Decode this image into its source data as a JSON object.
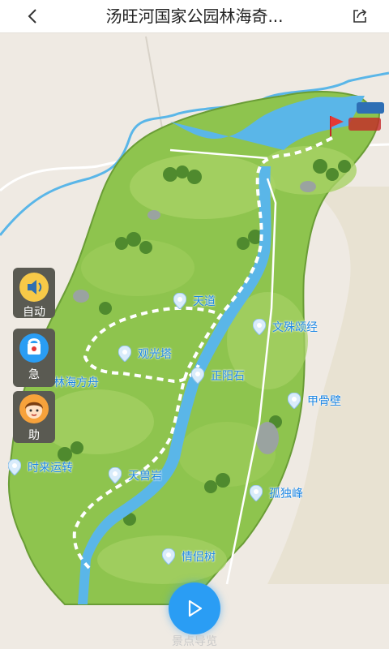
{
  "header": {
    "title": "汤旺河国家公园林海奇...",
    "back_icon": "chevron-left-icon",
    "share_icon": "share-icon"
  },
  "colors": {
    "water": "#5ab6e8",
    "park_green": "#8ec44e",
    "pin_blue": "#1e88e5",
    "route": "#ffffff",
    "button_blue": "#2a9df4"
  },
  "side_buttons": [
    {
      "label": "自动",
      "icon": "speaker-icon"
    },
    {
      "label": "急",
      "icon": "emergency-phone-icon"
    },
    {
      "label": "助",
      "icon": "guide-avatar-icon"
    }
  ],
  "pois": [
    {
      "name": "天道"
    },
    {
      "name": "文殊颂经"
    },
    {
      "name": "观光塔"
    },
    {
      "name": "林海方舟"
    },
    {
      "name": "正阳石"
    },
    {
      "name": "甲骨壁"
    },
    {
      "name": "时来运转"
    },
    {
      "name": "天兽岩"
    },
    {
      "name": "孤独峰"
    },
    {
      "name": "情侣树"
    }
  ],
  "guide": {
    "label": "景点导览",
    "icon": "play-icon"
  }
}
